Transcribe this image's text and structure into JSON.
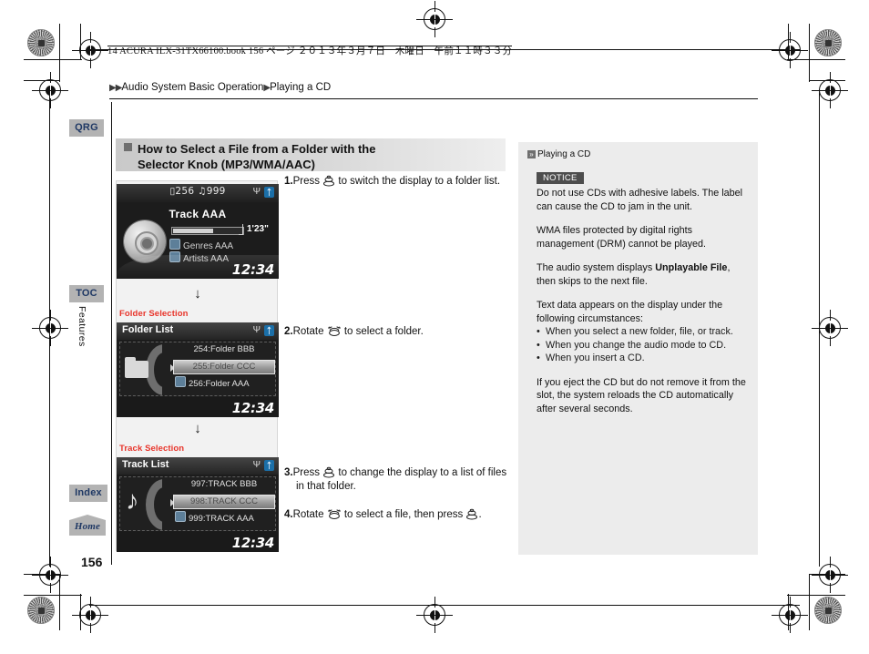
{
  "print": {
    "book_line": "14 ACURA ILX-31TX66100.book  156 ページ  ２０１３年３月７日　木曜日　午前１１時３３分"
  },
  "breadcrumb": {
    "marks": "▶▶",
    "section": "Audio System Basic Operation",
    "sep": "▶",
    "topic": "Playing a CD"
  },
  "rail": {
    "qrg": "QRG",
    "toc": "TOC",
    "features": "Features",
    "index": "Index",
    "home": "Home",
    "page_number": "156"
  },
  "heading": {
    "line1": "How to Select a File from a Folder with the",
    "line2": "Selector Knob (MP3/WMA/AAC)"
  },
  "illustration": {
    "screen1": {
      "folder_count": "256",
      "track_count": "999",
      "track_title": "Track AAA",
      "elapsed": "1'23\"",
      "genre": "Genres AAA",
      "artist": "Artists AAA",
      "clock": "12:34",
      "usb_icon": "usb-icon",
      "bt_icon": "bluetooth-icon",
      "disc_icon": "cd-disc-icon"
    },
    "label_folder": "Folder Selection",
    "screen2": {
      "header": "Folder List",
      "row1": "254:Folder BBB",
      "row2": "255:Folder CCC",
      "row3": "256:Folder AAA",
      "clock": "12:34",
      "thumb_icon": "folder-icon"
    },
    "label_track": "Track Selection",
    "screen3": {
      "header": "Track List",
      "row1": "997:TRACK BBB",
      "row2": "998:TRACK CCC",
      "row3": "999:TRACK AAA",
      "clock": "12:34",
      "thumb_icon": "music-note-icon"
    },
    "arrow_glyph": "↓"
  },
  "steps": [
    {
      "num": "1.",
      "pre": "Press ",
      "post": " to switch the display to a folder list.",
      "icon": "selector-knob-press-icon"
    },
    {
      "num": "2.",
      "pre": "Rotate ",
      "post": " to select a folder.",
      "icon": "selector-knob-rotate-icon"
    },
    {
      "num": "3.",
      "pre": "Press ",
      "post": " to change the display to a list of files in that folder.",
      "icon": "selector-knob-press-icon"
    },
    {
      "num": "4.",
      "pre": "Rotate ",
      "mid": " to select a file, then press ",
      "post": ".",
      "icon": "selector-knob-rotate-icon",
      "icon2": "selector-knob-press-icon"
    }
  ],
  "notice_panel": {
    "title": "Playing a CD",
    "notice_tag": "NOTICE",
    "p1": "Do not use CDs with adhesive labels. The label can cause the CD to jam in the unit.",
    "p2": "WMA files protected by digital rights management (DRM) cannot be played.",
    "p3_a": "The audio system displays ",
    "p3_b": "Unplayable File",
    "p3_c": ", then skips to the next file.",
    "p4": "Text data appears on the display under the following circumstances:",
    "bullets": [
      "When you select a new folder, file, or track.",
      "When you change the audio mode to CD.",
      "When you insert a CD."
    ],
    "p5": "If you eject the CD but do not remove it from the slot, the system reloads the CD automatically after several seconds."
  },
  "colors": {
    "accent_red": "#e8342a",
    "tab_gray": "#b3b3b3",
    "tab_text": "#1f3864",
    "panel_bg": "#ececec",
    "screen_bg": "#1c1c1c"
  }
}
